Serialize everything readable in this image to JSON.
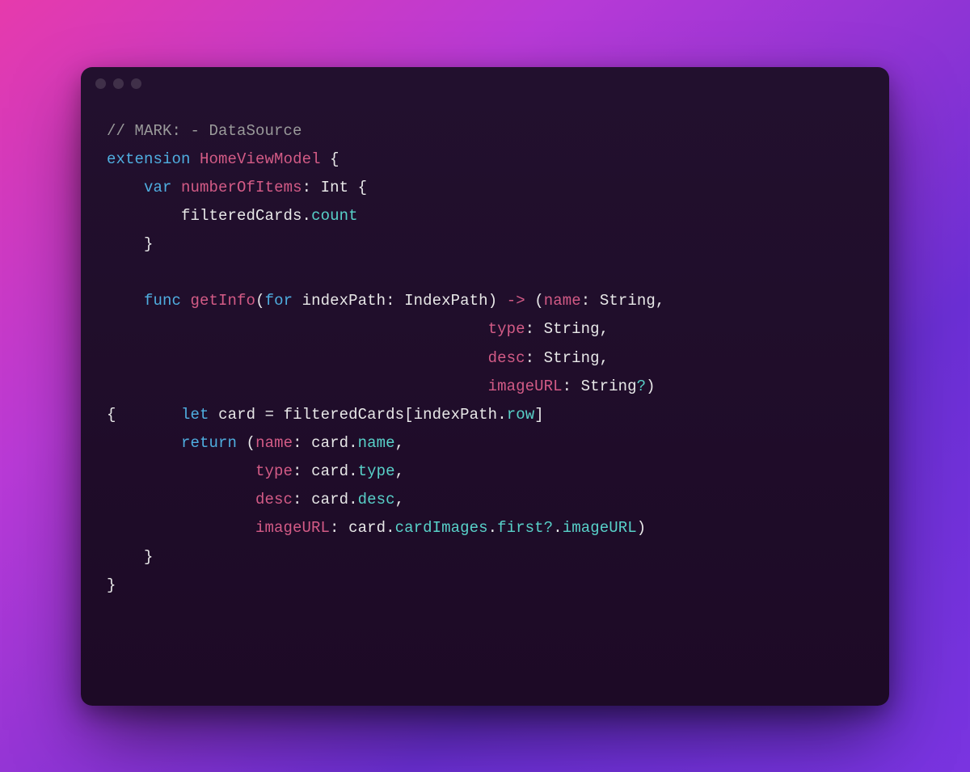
{
  "colors": {
    "bg_start": "#e63aac",
    "bg_end": "#7a34e0",
    "window": "#1f0e2a",
    "comment": "#9a9a9a",
    "keyword": "#4faee0",
    "typeuse": "#d35b86",
    "member": "#58d1c9",
    "plain": "#e8e8e8"
  },
  "window": {
    "traffic_lights": [
      "close",
      "minimize",
      "zoom"
    ]
  },
  "code": {
    "language": "swift",
    "t": {
      "l1_comment": "// MARK: - DataSource",
      "l2_kw_extension": "extension",
      "l2_type_HomeViewModel": "HomeViewModel",
      "l2_brace_open": " {",
      "l3_indent": "    ",
      "l3_kw_var": "var",
      "l3_name_numberOfItems": "numberOfItems",
      "l3_colon": ":",
      "l3_type_Int": "Int",
      "l3_brace_open": " {",
      "l4_indent": "        ",
      "l4_var_filteredCards": "filteredCards",
      "l4_dot": ".",
      "l4_mem_count": "count",
      "l5_indent": "    ",
      "l5_brace_close": "}",
      "blank": "",
      "l7_indent": "    ",
      "l7_kw_func": "func",
      "l7_name_getInfo": "getInfo",
      "l7_lparen": "(",
      "l7_kw_for": "for",
      "l7_param_indexPath": "indexPath",
      "l7_colon": ":",
      "l7_type_IndexPath": "IndexPath",
      "l7_rparen": ")",
      "l7_arrow": "->",
      "l7_tuple_lparen": "(",
      "l7_lbl_name": "name",
      "l7_lbl_colon": ":",
      "l7_type_String": "String",
      "l7_comma": ",",
      "l8_pad": "                                         ",
      "l8_lbl_type": "type",
      "l9_lbl_desc": "desc",
      "l10_lbl_imageURL": "imageURL",
      "l10_opt_q": "?",
      "l10_tuple_rparen": ")",
      "l11_brace_open": "{",
      "l11_pad": "       ",
      "l11_kw_let": "let",
      "l11_var_card": "card",
      "l11_eq": "=",
      "l11_var_filteredCards": "filteredCards",
      "l11_lbracket": "[",
      "l11_var_indexPath": "indexPath",
      "l11_dot": ".",
      "l11_mem_row": "row",
      "l11_rbracket": "]",
      "l12_indent": "        ",
      "l12_kw_return": "return",
      "l12_lparen": "(",
      "l12_lbl_name": "name",
      "l12_var_card": "card",
      "l12_mem_name": "name",
      "l13_pad": "                ",
      "l13_lbl_type": "type",
      "l13_mem_type": "type",
      "l14_lbl_desc": "desc",
      "l14_mem_desc": "desc",
      "l15_lbl_imageURL": "imageURL",
      "l15_mem_cardImages": "cardImages",
      "l15_mem_first": "first",
      "l15_opt_q": "?",
      "l15_mem_imageURL": "imageURL",
      "l15_rparen": ")",
      "l16_indent": "    ",
      "l16_brace_close": "}",
      "l17_brace_close": "}"
    }
  }
}
